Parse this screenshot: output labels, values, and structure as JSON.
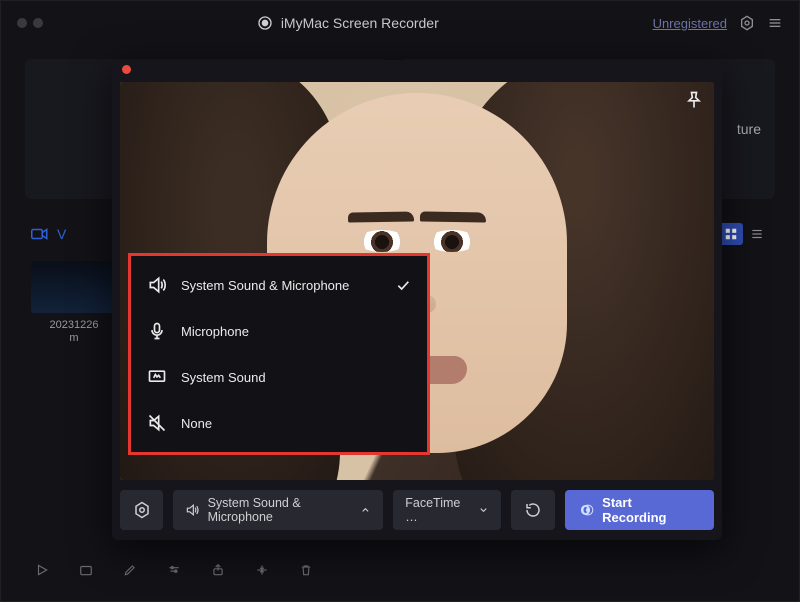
{
  "title_bar": {
    "app_name": "iMyMac Screen Recorder",
    "status_link": "Unregistered"
  },
  "main": {
    "mode_left": "Video",
    "mode_right": "ture",
    "library_tab": "V",
    "thumb_label": "20231226\nm"
  },
  "recorder": {
    "audio_select_label": "System Sound & Microphone",
    "camera_select_label": "FaceTime …",
    "start_label": "Start Recording"
  },
  "audio_menu": {
    "items": [
      {
        "icon": "speaker-loud-icon",
        "label": "System Sound & Microphone",
        "checked": true
      },
      {
        "icon": "microphone-icon",
        "label": "Microphone",
        "checked": false
      },
      {
        "icon": "system-sound-icon",
        "label": "System Sound",
        "checked": false
      },
      {
        "icon": "mute-icon",
        "label": "None",
        "checked": false
      }
    ]
  }
}
